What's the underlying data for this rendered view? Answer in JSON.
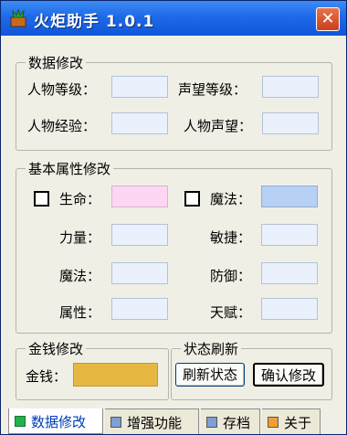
{
  "window": {
    "title": "火炬助手  1.0.1",
    "close_label": "✕"
  },
  "data_group": {
    "title": "数据修改",
    "fields": [
      {
        "label": "人物等级："
      },
      {
        "label": "声望等级："
      },
      {
        "label": "人物经验："
      },
      {
        "label": "人物声望："
      }
    ]
  },
  "attr_group": {
    "title": "基本属性修改",
    "life_label": "生命：",
    "magic_check_label": "魔法：",
    "strength_label": "力量：",
    "agility_label": "敏捷：",
    "magic_label": "魔法：",
    "defense_label": "防御：",
    "attribute_label": "属性：",
    "talent_label": "天赋：",
    "colors": {
      "life": "#fdd6f4",
      "magic": "#b8d0f4"
    }
  },
  "money_group": {
    "title": "金钱修改",
    "label": "金钱：",
    "color": "#e6b842"
  },
  "status_group": {
    "title": "状态刷新",
    "refresh_button": "刷新状态",
    "confirm_button": "确认修改"
  },
  "tabs": [
    {
      "label": "数据修改",
      "color": "#22b14c",
      "active": true
    },
    {
      "label": "增强功能",
      "color": "#7f9fd5",
      "active": false
    },
    {
      "label": "存档",
      "color": "#7f9fd5",
      "active": false
    },
    {
      "label": "关于",
      "color": "#f0a030",
      "active": false
    }
  ]
}
